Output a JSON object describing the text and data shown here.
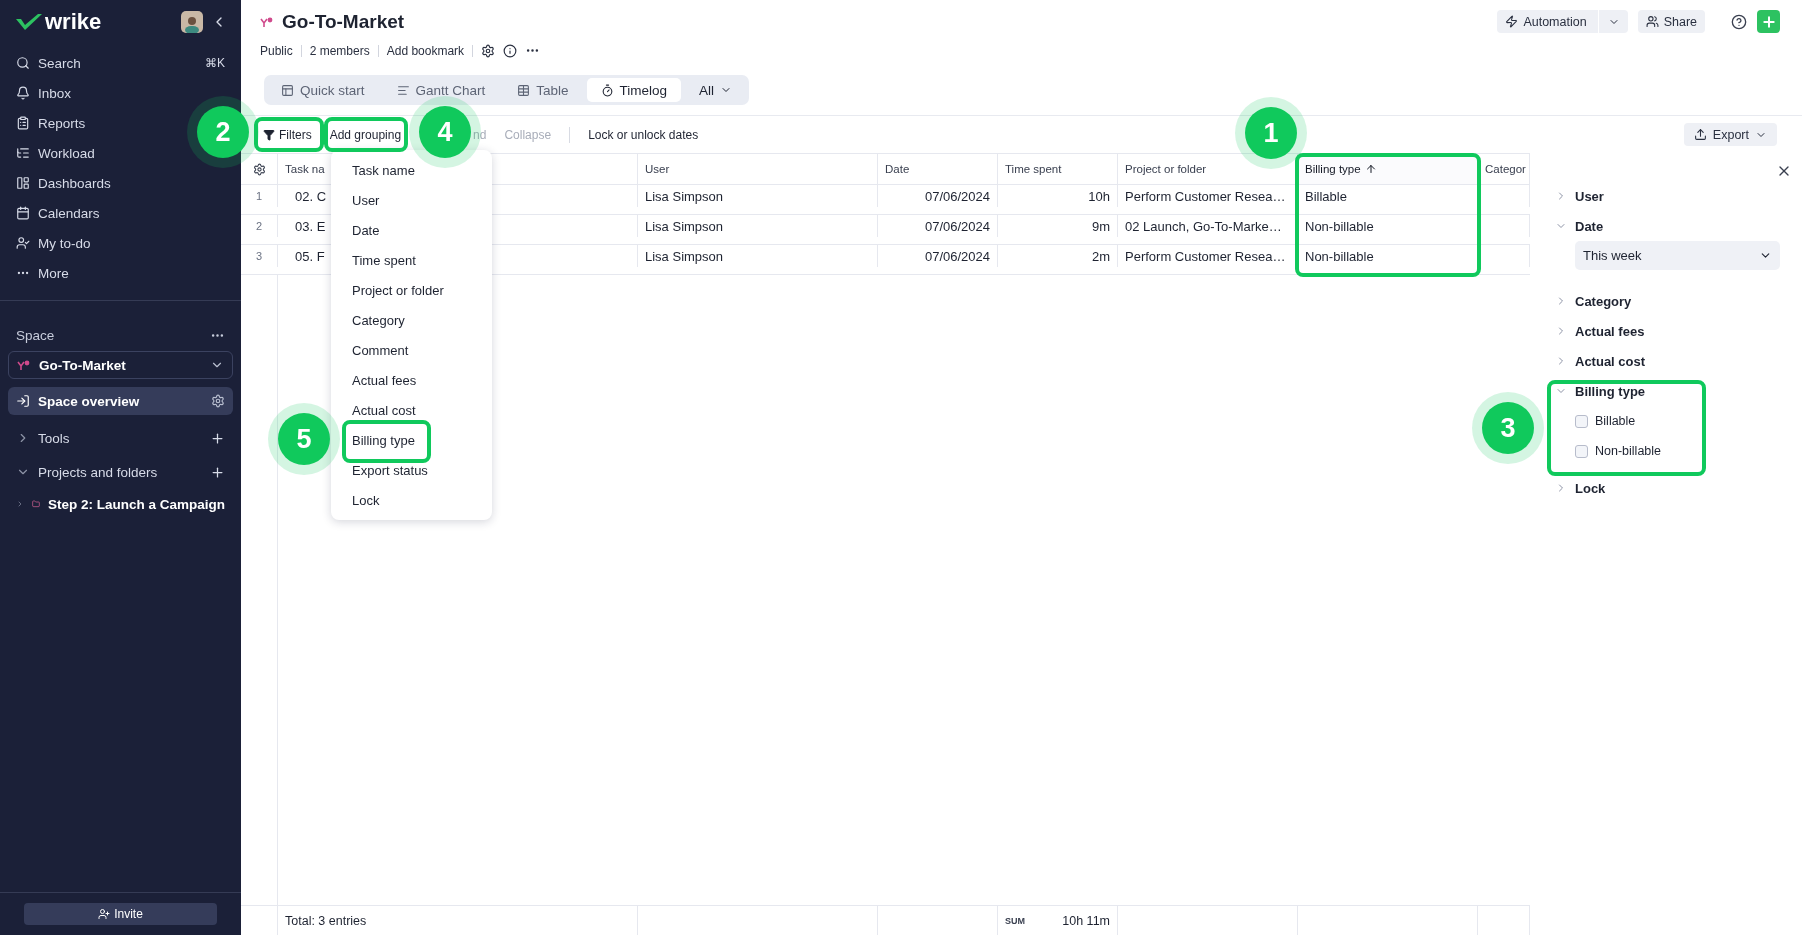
{
  "sidebar": {
    "logo": "wrike",
    "nav": [
      {
        "label": "Search",
        "shortcut": "⌘K"
      },
      {
        "label": "Inbox"
      },
      {
        "label": "Reports"
      },
      {
        "label": "Workload"
      },
      {
        "label": "Dashboards"
      },
      {
        "label": "Calendars"
      },
      {
        "label": "My to-do"
      },
      {
        "label": "More"
      }
    ],
    "space_label": "Space",
    "space_selector": "Go-To-Market",
    "overview": {
      "label": "Space overview",
      "selected": true
    },
    "sections": [
      {
        "label": "Tools",
        "expanded": false
      },
      {
        "label": "Projects and folders",
        "expanded": true,
        "children": [
          {
            "label": "Step 2: Launch a Campaign",
            "expanded": false
          }
        ]
      }
    ],
    "invite": "Invite"
  },
  "header": {
    "title": "Go-To-Market",
    "meta": [
      "Public",
      "2 members",
      "Add bookmark"
    ],
    "automation": "Automation",
    "share": "Share"
  },
  "tabs": [
    {
      "label": "Quick start",
      "selected": false
    },
    {
      "label": "Gantt Chart",
      "selected": false
    },
    {
      "label": "Table",
      "selected": false
    },
    {
      "label": "Timelog",
      "selected": true
    }
  ],
  "views_menu": "All",
  "toolbar": {
    "actions": [
      {
        "label": "Filters",
        "kind": "filter",
        "disabled": false
      },
      {
        "label": "Add grouping",
        "kind": "plain",
        "disabled": false
      },
      {
        "label": "nd",
        "kind": "covered",
        "disabled": true
      },
      {
        "label": "Collapse",
        "kind": "plain",
        "disabled": true
      },
      {
        "label": "Lock or unlock dates",
        "kind": "separated",
        "disabled": false
      }
    ],
    "export": "Export"
  },
  "table": {
    "columns": [
      {
        "label": "Task na",
        "sorted": false
      },
      {
        "label": "User",
        "sorted": false
      },
      {
        "label": "Date",
        "sorted": false
      },
      {
        "label": "Time spent",
        "sorted": false
      },
      {
        "label": "Project or folder",
        "sorted": false
      },
      {
        "label": "Billing type",
        "sorted": true
      },
      {
        "label": "Categor",
        "sorted": false
      }
    ],
    "rows": [
      {
        "number": "1",
        "cells": [
          "02. C",
          "Lisa Simpson",
          "07/06/2024",
          "10h",
          "Perform Customer Resea…",
          "Billable"
        ]
      },
      {
        "number": "2",
        "cells": [
          "03. E",
          "Lisa Simpson",
          "07/06/2024",
          "9m",
          "02 Launch, Go-To-Marke…",
          "Non-billable"
        ]
      },
      {
        "number": "3",
        "cells": [
          "05. F",
          "Lisa Simpson",
          "07/06/2024",
          "2m",
          "Perform Customer Resea…",
          "Non-billable"
        ]
      }
    ],
    "footer": {
      "total": "Total: 3 entries",
      "sum_label": "SUM",
      "sum": "10h 11m"
    }
  },
  "grouping_menu": [
    "Task name",
    "User",
    "Date",
    "Time spent",
    "Project or folder",
    "Category",
    "Comment",
    "Actual fees",
    "Actual cost",
    "Billing type",
    "Export status",
    "Lock"
  ],
  "filter_panel": [
    {
      "label": "User",
      "expanded": false
    },
    {
      "label": "Date",
      "kind": "select",
      "expanded": true,
      "value": "This week"
    },
    {
      "label": "Category",
      "expanded": false
    },
    {
      "label": "Actual fees",
      "expanded": false
    },
    {
      "label": "Actual cost",
      "expanded": false
    },
    {
      "label": "Billing type",
      "kind": "checkboxes",
      "expanded": true,
      "options": [
        {
          "label": "Billable",
          "checked": false
        },
        {
          "label": "Non-billable",
          "checked": false
        }
      ]
    },
    {
      "label": "Lock",
      "expanded": false
    }
  ],
  "callouts": [
    "2",
    "4",
    "1",
    "5",
    "3"
  ]
}
